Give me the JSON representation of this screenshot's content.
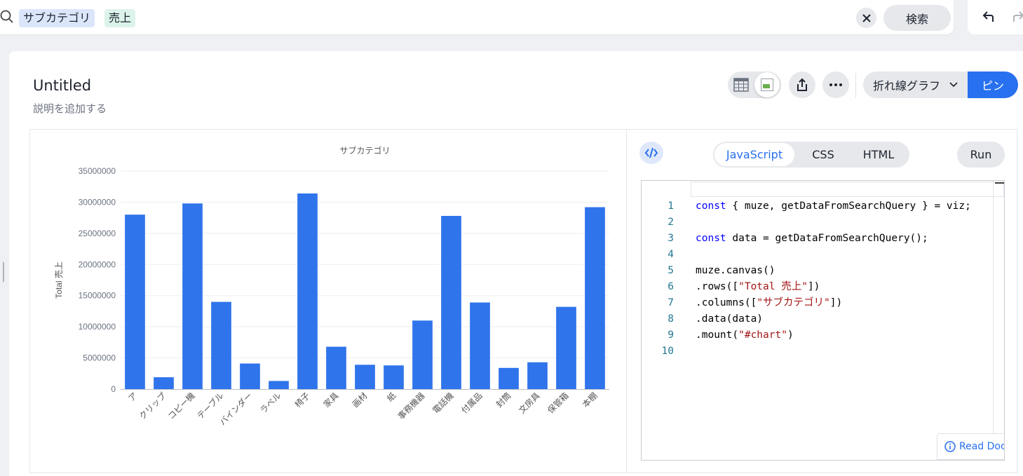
{
  "search": {
    "tokens": [
      {
        "label": "サブカテゴリ",
        "kind": "attribute"
      },
      {
        "label": "売上",
        "kind": "measure"
      }
    ],
    "search_button": "検索"
  },
  "answer": {
    "title": "Untitled",
    "description": "説明を追加する"
  },
  "toolbar": {
    "chart_type": "折れ線グラフ",
    "pin_label": "ピン"
  },
  "editor": {
    "tabs": [
      "JavaScript",
      "CSS",
      "HTML"
    ],
    "active_tab": "JavaScript",
    "run_label": "Run",
    "read_docs_label": "Read Docs",
    "line_numbers": [
      "1",
      "2",
      "3",
      "4",
      "5",
      "6",
      "7",
      "8",
      "9",
      "10"
    ]
  },
  "colors": {
    "accent": "#2770ef",
    "bar": "#2f74eb",
    "keyword": "#0000ff",
    "string": "#a31515"
  },
  "chart_data": {
    "type": "bar",
    "title": "サブカテゴリ",
    "xlabel": "",
    "ylabel": "Total 売上",
    "ylim": [
      0,
      35000000
    ],
    "yticks": [
      "0",
      "5000000",
      "10000000",
      "15000000",
      "20000000",
      "25000000",
      "30000000",
      "35000000"
    ],
    "grid": true,
    "categories": [
      "ア",
      "クリップ",
      "コピー機",
      "テーブル",
      "バインダー",
      "ラベル",
      "椅子",
      "家具",
      "画材",
      "紙",
      "事務機器",
      "電話機",
      "付属品",
      "封筒",
      "文房具",
      "保管箱",
      "本棚"
    ],
    "values": [
      28000000,
      1900000,
      29800000,
      14000000,
      4100000,
      1300000,
      31400000,
      6800000,
      3900000,
      3800000,
      11000000,
      27800000,
      13900000,
      3400000,
      4300000,
      13200000,
      29200000
    ]
  }
}
